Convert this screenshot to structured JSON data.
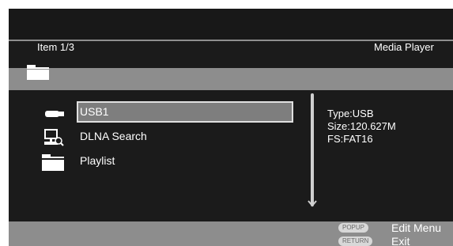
{
  "header": {
    "item_counter": "Item 1/3",
    "app_title": "Media Player"
  },
  "path_bar": {
    "icon": "folder-icon"
  },
  "list": {
    "items": [
      {
        "label": "USB1",
        "icon": "usb-drive-icon",
        "selected": true
      },
      {
        "label": "DLNA Search",
        "icon": "network-search-icon",
        "selected": false
      },
      {
        "label": "Playlist",
        "icon": "folder-icon",
        "selected": false
      }
    ]
  },
  "details": {
    "type": "Type:USB",
    "size": "Size:120.627M",
    "fs": "FS:FAT16"
  },
  "footer": {
    "keys": [
      {
        "key": "POPUP",
        "action": "Edit Menu"
      },
      {
        "key": "RETURN",
        "action": "Exit"
      }
    ]
  },
  "colors": {
    "background": "#1b1b1b",
    "bar": "#8d8d8d",
    "highlight": "#7e7e7e",
    "text": "#ffffff"
  }
}
